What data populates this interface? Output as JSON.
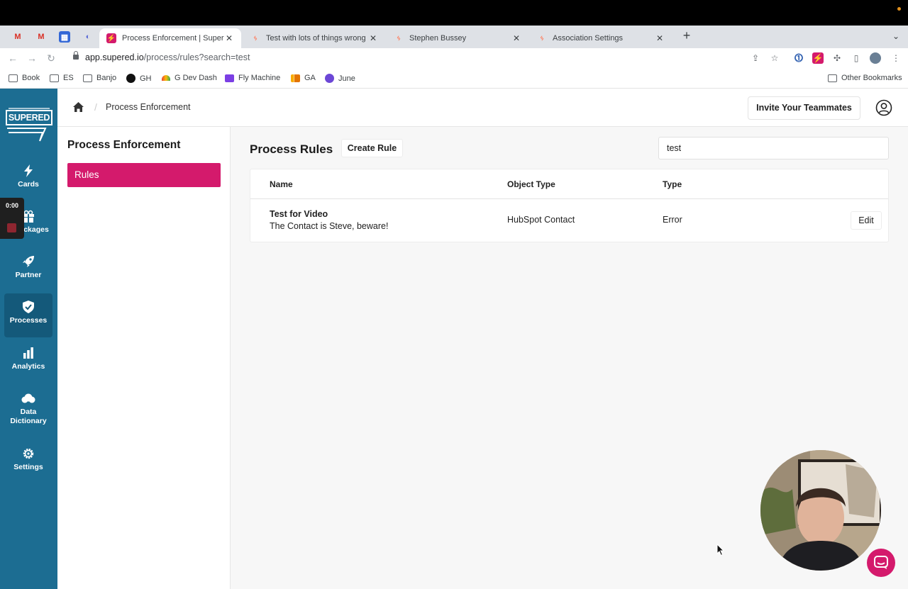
{
  "browser": {
    "tabs": [
      {
        "title": "Process Enforcement | Supered",
        "active": true
      },
      {
        "title": "Test with lots of things wrong",
        "active": false
      },
      {
        "title": "Stephen Bussey",
        "active": false
      },
      {
        "title": "Association Settings",
        "active": false
      }
    ],
    "url": {
      "host": "app.supered.io",
      "path": "/process/rules?search=test"
    },
    "bookmarks": [
      "Book",
      "ES",
      "Banjo",
      "GH",
      "G Dev Dash",
      "Fly Machine",
      "GA",
      "June"
    ],
    "other_bookmarks": "Other Bookmarks"
  },
  "recorder": {
    "time": "0:00"
  },
  "sidebar": {
    "logo": "SUPERED",
    "items": [
      {
        "label": "Cards",
        "icon": "bolt-icon"
      },
      {
        "label": "ckages",
        "icon": "gift-icon"
      },
      {
        "label": "Partner",
        "icon": "rocket-icon"
      },
      {
        "label": "Processes",
        "icon": "shield-check-icon",
        "active": true
      },
      {
        "label": "Analytics",
        "icon": "bar-chart-icon"
      },
      {
        "label": "Data Dictionary",
        "icon": "cloud-icon"
      },
      {
        "label": "Settings",
        "icon": "gear-icon"
      }
    ]
  },
  "header": {
    "breadcrumb": "Process Enforcement",
    "invite_label": "Invite Your Teammates"
  },
  "left_pane": {
    "title": "Process Enforcement",
    "rules_label": "Rules"
  },
  "main": {
    "title": "Process Rules",
    "create_label": "Create Rule",
    "search_value": "test",
    "columns": [
      "Name",
      "Object Type",
      "Type"
    ],
    "rows": [
      {
        "name": "Test for Video",
        "description": "The Contact is Steve, beware!",
        "object_type": "HubSpot Contact",
        "type": "Error",
        "action": "Edit"
      }
    ]
  },
  "colors": {
    "brand_sidebar": "#1c6d92",
    "accent": "#d41a6c"
  }
}
